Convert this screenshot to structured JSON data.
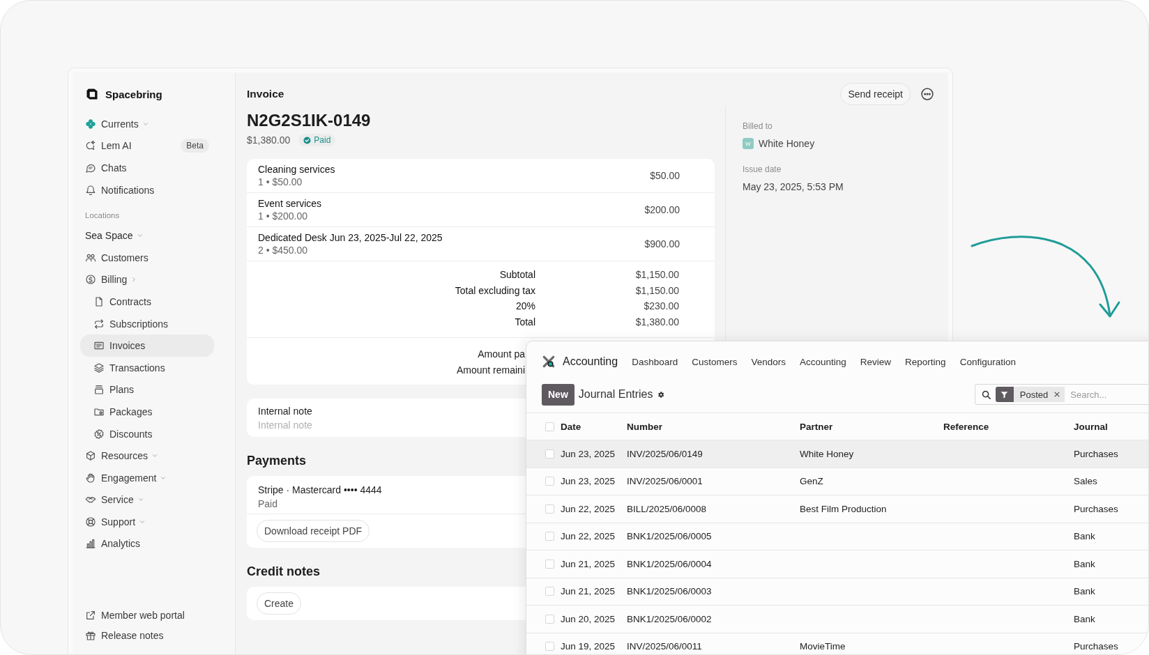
{
  "sidebar": {
    "brand": "Spacebring",
    "items": [
      {
        "label": "Currents",
        "kind": "group",
        "expanded": true,
        "selected": false
      },
      {
        "label": "Lem AI",
        "kind": "link",
        "badge": "Beta",
        "selected": false
      },
      {
        "label": "Chats",
        "kind": "link",
        "selected": false
      },
      {
        "label": "Notifications",
        "kind": "link",
        "selected": false
      },
      {
        "label": "Locations",
        "kind": "heading"
      },
      {
        "label": "Sea Space",
        "kind": "location",
        "expanded": true,
        "selected": false
      },
      {
        "label": "Customers",
        "kind": "link",
        "selected": false
      },
      {
        "label": "Billing",
        "kind": "group",
        "expanded": false,
        "selected": false
      },
      {
        "label": "Contracts",
        "kind": "sub",
        "selected": false
      },
      {
        "label": "Subscriptions",
        "kind": "sub",
        "selected": false
      },
      {
        "label": "Invoices",
        "kind": "sub",
        "selected": true
      },
      {
        "label": "Transactions",
        "kind": "sub",
        "selected": false
      },
      {
        "label": "Plans",
        "kind": "sub",
        "selected": false
      },
      {
        "label": "Packages",
        "kind": "sub",
        "selected": false
      },
      {
        "label": "Discounts",
        "kind": "sub",
        "selected": false
      },
      {
        "label": "Resources",
        "kind": "group",
        "expanded": true,
        "selected": false
      },
      {
        "label": "Engagement",
        "kind": "group",
        "expanded": true,
        "selected": false
      },
      {
        "label": "Service",
        "kind": "group",
        "expanded": true,
        "selected": false
      },
      {
        "label": "Support",
        "kind": "group",
        "expanded": true,
        "selected": false
      },
      {
        "label": "Analytics",
        "kind": "link",
        "selected": false
      }
    ],
    "footer_items": [
      {
        "label": "Member web portal"
      },
      {
        "label": "Release notes"
      }
    ]
  },
  "invoice": {
    "title": "Invoice",
    "send_button": "Send receipt",
    "number": "N2G2S1IK-0149",
    "amount": "$1,380.00",
    "status": "Paid",
    "line_items": [
      {
        "name": "Cleaning services",
        "detail": "1 • $50.00",
        "amount": "$50.00"
      },
      {
        "name": "Event services",
        "detail": "1 • $200.00",
        "amount": "$200.00"
      },
      {
        "name": "Dedicated Desk Jun 23, 2025-Jul 22, 2025",
        "detail": "2 • $450.00",
        "amount": "$900.00"
      }
    ],
    "totals": [
      {
        "label": "Subtotal",
        "value": "$1,150.00"
      },
      {
        "label": "Total excluding tax",
        "value": "$1,150.00"
      },
      {
        "label": "20%",
        "value": "$230.00"
      },
      {
        "label": "Total",
        "value": "$1,380.00"
      }
    ],
    "payment_rows": [
      {
        "label": "Amount pa"
      },
      {
        "label": "Amount remaini"
      }
    ],
    "note": {
      "label": "Internal note",
      "placeholder": "Internal note"
    },
    "payments_heading": "Payments",
    "payment": {
      "method": "Stripe · Mastercard •••• 4444",
      "status": "Paid",
      "button": "Download receipt PDF"
    },
    "credit_heading": "Credit notes",
    "credit_button": "Create",
    "billed_to_label": "Billed to",
    "customer": {
      "initial": "W",
      "name": "White Honey"
    },
    "issue_label": "Issue date",
    "issue_date": "May 23, 2025, 5:53 PM"
  },
  "accounting": {
    "app": "Accounting",
    "nav": [
      "Dashboard",
      "Customers",
      "Vendors",
      "Accounting",
      "Review",
      "Reporting",
      "Configuration"
    ],
    "new_button": "New",
    "view_title": "Journal Entries",
    "search": {
      "facet": "Posted",
      "placeholder": "Search..."
    },
    "table": {
      "all_checked": false,
      "columns": [
        "Date",
        "Number",
        "Partner",
        "Reference",
        "Journal"
      ],
      "rows": [
        {
          "cells": [
            "Jun 23, 2025",
            "INV/2025/06/0149",
            "White Honey",
            "",
            "Purchases"
          ],
          "selected": true,
          "checked": false
        },
        {
          "cells": [
            "Jun 23, 2025",
            "INV/2025/06/0001",
            "GenZ",
            "",
            "Sales"
          ],
          "selected": false,
          "checked": false
        },
        {
          "cells": [
            "Jun 22, 2025",
            "BILL/2025/06/0008",
            "Best Film Production",
            "",
            "Purchases"
          ],
          "selected": false,
          "checked": false
        },
        {
          "cells": [
            "Jun 22, 2025",
            "BNK1/2025/06/0005",
            "",
            "",
            "Bank"
          ],
          "selected": false,
          "checked": false
        },
        {
          "cells": [
            "Jun 21, 2025",
            "BNK1/2025/06/0004",
            "",
            "",
            "Bank"
          ],
          "selected": false,
          "checked": false
        },
        {
          "cells": [
            "Jun 21, 2025",
            "BNK1/2025/06/0003",
            "",
            "",
            "Bank"
          ],
          "selected": false,
          "checked": false
        },
        {
          "cells": [
            "Jun 20, 2025",
            "BNK1/2025/06/0002",
            "",
            "",
            "Bank"
          ],
          "selected": false,
          "checked": false
        },
        {
          "cells": [
            "Jun 19, 2025",
            "INV/2025/06/0011",
            "MovieTime",
            "",
            "Purchases"
          ],
          "selected": false,
          "checked": false
        }
      ]
    }
  }
}
